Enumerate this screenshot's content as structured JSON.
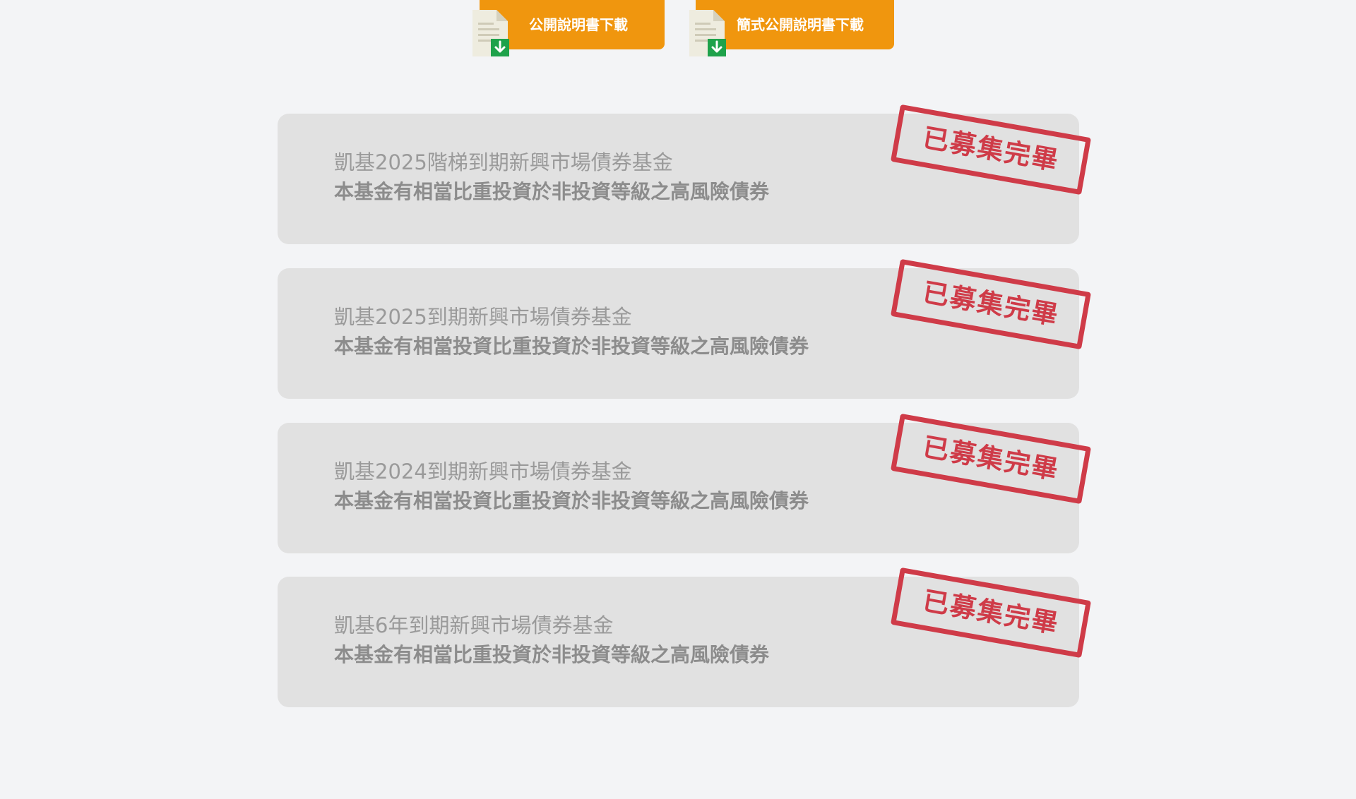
{
  "downloads": {
    "prospectus_label": "公開說明書下載",
    "simplified_prospectus_label": "簡式公開說明書下載",
    "icon": "document-download-icon"
  },
  "funds": [
    {
      "name": "凱基2025階梯到期新興市場債券基金",
      "warning": "本基金有相當比重投資於非投資等級之高風險債券",
      "status": "已募集完畢"
    },
    {
      "name": "凱基2025到期新興市場債券基金",
      "warning": "本基金有相當投資比重投資於非投資等級之高風險債券",
      "status": "已募集完畢"
    },
    {
      "name": "凱基2024到期新興市場債券基金",
      "warning": "本基金有相當投資比重投資於非投資等級之高風險債券",
      "status": "已募集完畢"
    },
    {
      "name": "凱基6年到期新興市場債券基金",
      "warning": "本基金有相當比重投資於非投資等級之高風險債券",
      "status": "已募集完畢"
    }
  ],
  "colors": {
    "page_background": "#f3f4f6",
    "button_orange": "#f0960e",
    "card_background": "#e1e1e1",
    "stamp_red": "#cf3b48",
    "icon_green": "#1ea24b"
  }
}
